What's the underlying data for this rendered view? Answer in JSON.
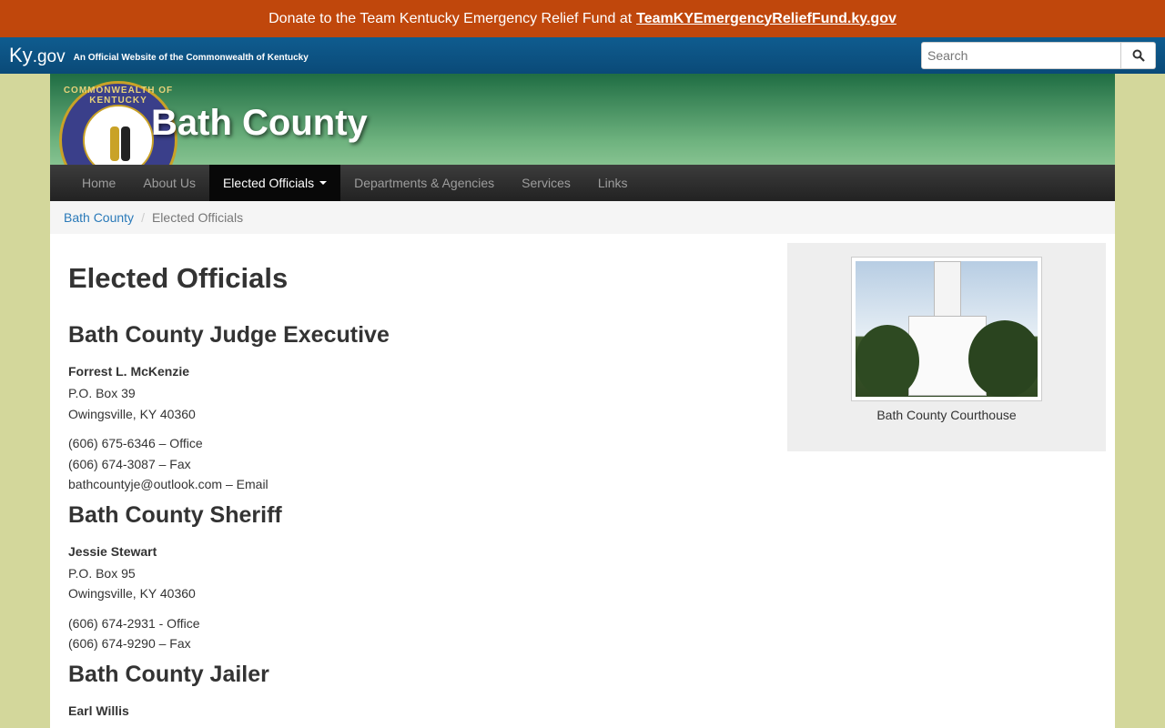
{
  "donate": {
    "text": "Donate to the Team Kentucky Emergency Relief Fund at",
    "link": "TeamKYEmergencyReliefFund.ky.gov"
  },
  "kybar": {
    "logo_main": "Ky",
    "logo_suffix": ".gov",
    "tagline": "An Official Website of the Commonwealth of Kentucky",
    "search_placeholder": "Search"
  },
  "banner": {
    "seal_text": "COMMONWEALTH OF KENTUCKY",
    "title": "Bath County"
  },
  "nav": {
    "items": [
      {
        "label": "Home"
      },
      {
        "label": "About Us"
      },
      {
        "label": "Elected Officials"
      },
      {
        "label": "Departments & Agencies"
      },
      {
        "label": "Services"
      },
      {
        "label": "Links"
      }
    ]
  },
  "breadcrumb": {
    "home": "Bath County",
    "current": "Elected Officials"
  },
  "page": {
    "title": "Elected Officials",
    "sections": [
      {
        "heading": "Bath County Judge Executive",
        "name": "Forrest L. McKenzie",
        "address1": "P.O. Box 39",
        "address2": "Owingsville, KY 40360",
        "contact1": "(606) 675-6346 – Office",
        "contact2": "(606) 674-3087 – Fax",
        "contact3": "bathcountyje@outlook.com – Email"
      },
      {
        "heading": "Bath County Sheriff",
        "name": "Jessie Stewart",
        "address1": "P.O. Box 95",
        "address2": "Owingsville, KY 40360",
        "contact1": "(606) 674-2931 - Office",
        "contact2": "(606) 674-9290 – Fax"
      },
      {
        "heading": "Bath County Jailer",
        "name": "Earl Willis"
      }
    ]
  },
  "sidebar": {
    "caption": "Bath County Courthouse"
  },
  "colors": {
    "donate_bg": "#c0470c",
    "kybar_bg": "#0a4a78",
    "page_bg": "#d3d79b",
    "nav_bg": "#222222",
    "link": "#2a7ab9"
  }
}
